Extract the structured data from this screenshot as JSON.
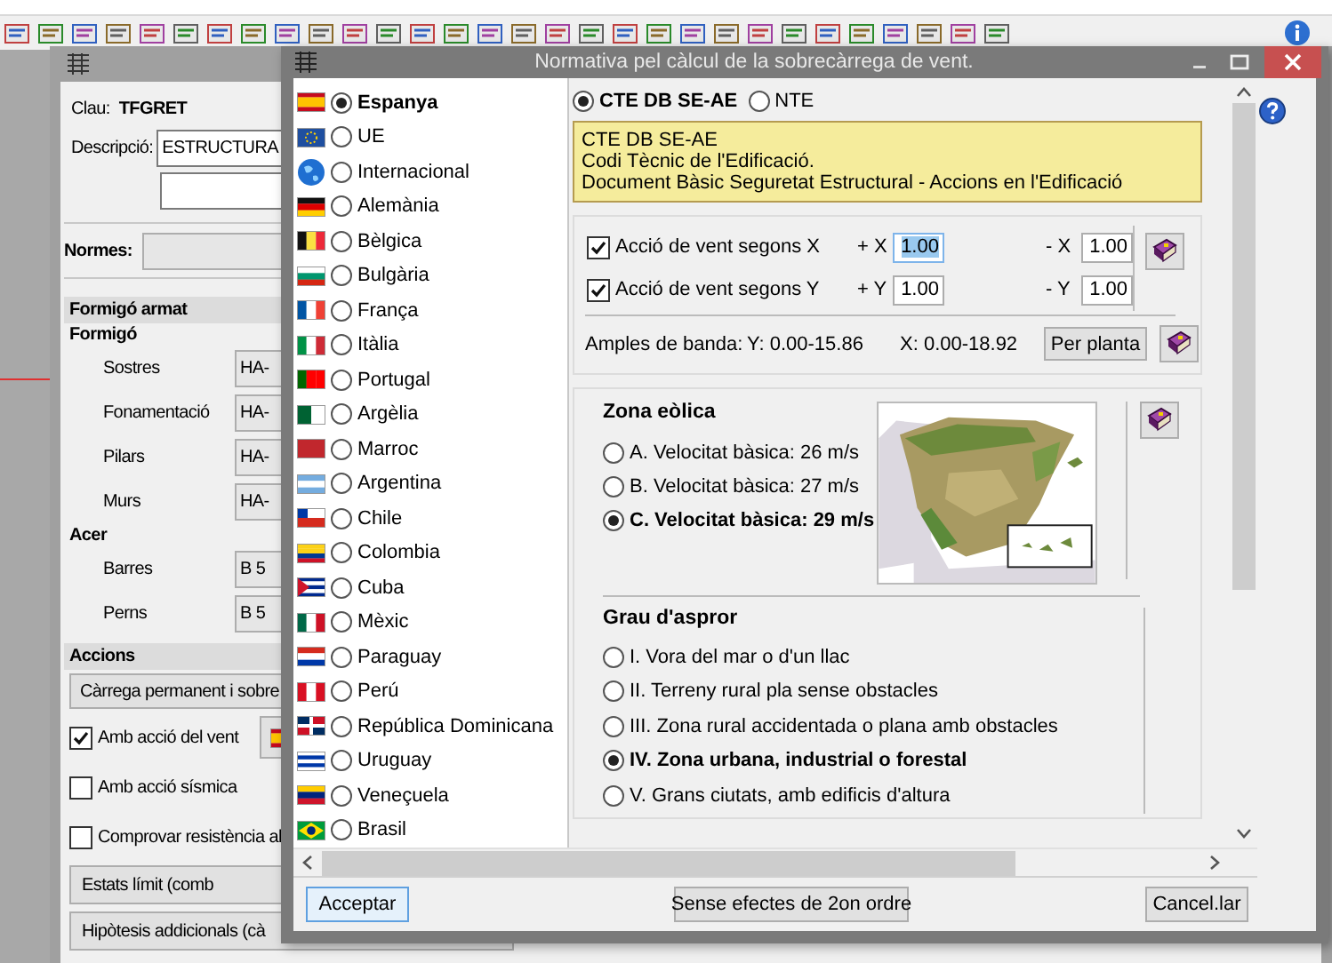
{
  "back_window": {
    "items": [
      {
        "kind": "key",
        "label": "Clau:",
        "value": "TFGRET"
      },
      {
        "kind": "field",
        "label": "Descripció:",
        "value": "ESTRUCTURA"
      },
      {
        "kind": "blank_field"
      },
      {
        "kind": "combo",
        "label": "Normes:"
      },
      {
        "kind": "section",
        "label": "Formigó armat"
      },
      {
        "kind": "group",
        "label": "Formigó"
      },
      {
        "kind": "select",
        "label": "Sostres",
        "value": "HA-"
      },
      {
        "kind": "select",
        "label": "Fonamentació",
        "value": "HA-"
      },
      {
        "kind": "select",
        "label": "Pilars",
        "value": "HA-"
      },
      {
        "kind": "select",
        "label": "Murs",
        "value": "HA-"
      },
      {
        "kind": "group",
        "label": "Acer"
      },
      {
        "kind": "select",
        "label": "Barres",
        "value": "B 5"
      },
      {
        "kind": "select",
        "label": "Perns",
        "value": "B 5"
      },
      {
        "kind": "section",
        "label": "Accions"
      },
      {
        "kind": "button",
        "label": "Càrrega permanent i sobre"
      },
      {
        "kind": "checkbox",
        "label": "Amb acció del vent",
        "checked": true
      },
      {
        "kind": "checkbox",
        "label": "Amb acció sísmica",
        "checked": false
      },
      {
        "kind": "checkbox",
        "label": "Comprovar resistència al",
        "checked": false
      },
      {
        "kind": "wide_button",
        "label": "Estats límit (comb"
      },
      {
        "kind": "wide_button",
        "label": "Hipòtesis addicionals (cà"
      }
    ]
  },
  "dialog": {
    "title": "Normativa pel càlcul de la sobrecàrrega de vent.",
    "countries": [
      {
        "name": "Espanya",
        "selected": true
      },
      {
        "name": "UE",
        "selected": false
      },
      {
        "name": "Internacional",
        "selected": false
      },
      {
        "name": "Alemània",
        "selected": false
      },
      {
        "name": "Bèlgica",
        "selected": false
      },
      {
        "name": "Bulgària",
        "selected": false
      },
      {
        "name": "França",
        "selected": false
      },
      {
        "name": "Itàlia",
        "selected": false
      },
      {
        "name": "Portugal",
        "selected": false
      },
      {
        "name": "Argèlia",
        "selected": false
      },
      {
        "name": "Marroc",
        "selected": false
      },
      {
        "name": "Argentina",
        "selected": false
      },
      {
        "name": "Chile",
        "selected": false
      },
      {
        "name": "Colombia",
        "selected": false
      },
      {
        "name": "Cuba",
        "selected": false
      },
      {
        "name": "Mèxic",
        "selected": false
      },
      {
        "name": "Paraguay",
        "selected": false
      },
      {
        "name": "Perú",
        "selected": false
      },
      {
        "name": "República Dominicana",
        "selected": false
      },
      {
        "name": "Uruguay",
        "selected": false
      },
      {
        "name": "Veneçuela",
        "selected": false
      },
      {
        "name": "Brasil",
        "selected": false
      }
    ],
    "codes": [
      {
        "label": "CTE DB SE-AE",
        "selected": true
      },
      {
        "label": "NTE",
        "selected": false
      }
    ],
    "info_lines": [
      "CTE DB SE-AE",
      "Codi Tècnic de l'Edificació.",
      "Document Bàsic Seguretat Estructural - Accions en l'Edificació"
    ],
    "wind_rows": [
      {
        "label": "Acció de vent segons X",
        "checked": true,
        "plus_label": "+ X",
        "plus_value": "1.00",
        "plus_focused": true,
        "minus_label": "- X",
        "minus_value": "1.00"
      },
      {
        "label": "Acció de vent segons Y",
        "checked": true,
        "plus_label": "+ Y",
        "plus_value": "1.00",
        "plus_focused": false,
        "minus_label": "- Y",
        "minus_value": "1.00"
      }
    ],
    "bandwidth": {
      "label": "Amples de banda:",
      "y_range": "Y: 0.00-15.86",
      "x_range": "X: 0.00-18.92",
      "button": "Per planta"
    },
    "zone": {
      "title": "Zona eòlica",
      "options": [
        {
          "label": "A. Velocitat bàsica: 26 m/s",
          "selected": false
        },
        {
          "label": "B. Velocitat bàsica: 27 m/s",
          "selected": false
        },
        {
          "label": "C. Velocitat bàsica: 29 m/s",
          "selected": true
        }
      ]
    },
    "roughness": {
      "title": "Grau d'aspror",
      "options": [
        {
          "label": "I. Vora del mar o d'un llac",
          "selected": false
        },
        {
          "label": "II. Terreny rural pla sense obstacles",
          "selected": false
        },
        {
          "label": "III. Zona rural accidentada o plana amb obstacles",
          "selected": false
        },
        {
          "label": "IV. Zona urbana, industrial o forestal",
          "selected": true
        },
        {
          "label": "V. Grans ciutats, amb edificis d'altura",
          "selected": false
        }
      ]
    },
    "buttons": {
      "accept": "Acceptar",
      "second_order": "Sense efectes de 2on ordre",
      "cancel": "Cancel.lar"
    }
  }
}
